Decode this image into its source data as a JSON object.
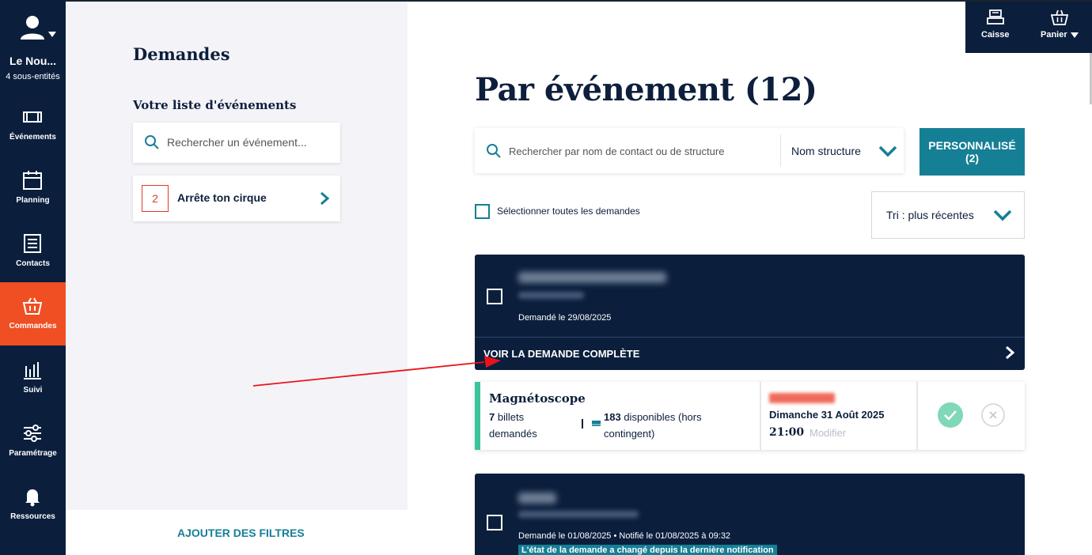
{
  "nav": {
    "user": {
      "name": "Le Nou...",
      "sub": "4 sous-entités"
    },
    "items": [
      {
        "label": "Événements",
        "icon": "ticket-icon"
      },
      {
        "label": "Planning",
        "icon": "calendar-icon"
      },
      {
        "label": "Contacts",
        "icon": "contacts-icon"
      },
      {
        "label": "Commandes",
        "icon": "basket-icon",
        "active": true
      },
      {
        "label": "Suivi",
        "icon": "chart-icon"
      },
      {
        "label": "Paramétrage",
        "icon": "sliders-icon"
      },
      {
        "label": "Ressources",
        "icon": "bell-icon"
      }
    ]
  },
  "panel": {
    "title": "Demandes",
    "subtitle": "Votre liste d'événements",
    "search_placeholder": "Rechercher un événement...",
    "event": {
      "count": "2",
      "name": "Arrête ton cirque"
    },
    "add_filters": "AJOUTER DES FILTRES"
  },
  "topbar": {
    "caisse": "Caisse",
    "panier": "Panier"
  },
  "main": {
    "title": "Par événement (12)",
    "search_placeholder": "Rechercher par nom de contact ou de structure",
    "search_field": "Nom structure",
    "personalise": "PERSONNALISÉ",
    "personalise_count": "(2)",
    "select_all": "Sélectionner toutes les demandes",
    "sort": "Tri : plus récentes",
    "requests": [
      {
        "date": "Demandé le 29/08/2025",
        "view_label": "VOIR LA DEMANDE COMPLÈTE",
        "product": {
          "name": "Magnétoscope",
          "requested_count": "7",
          "requested_label": "billets demandés",
          "available_count": "183",
          "available_label": "disponibles (hors contingent)",
          "event_day": "Dimanche 31 Août 2025",
          "event_time": "21:00",
          "modify": "Modifier"
        }
      },
      {
        "date": "Demandé le 01/08/2025 • Notifié le 01/08/2025 à 09:32",
        "badge": "L'état de la demande a changé depuis la dernière notification"
      }
    ]
  },
  "colors": {
    "nav_bg": "#0b1f3d",
    "active": "#f04e23",
    "accent": "#157f95",
    "accept": "#7fd8b6",
    "status_bar": "#3ac49c"
  }
}
